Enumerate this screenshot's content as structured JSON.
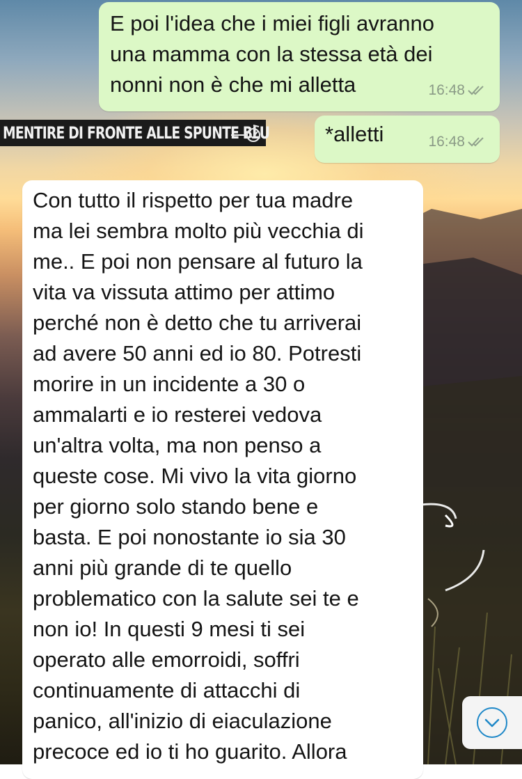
{
  "messages": [
    {
      "direction": "outgoing",
      "text": "E poi l'idea che i miei figli avranno\nuna mamma con la stessa età dei\nnonni non è che mi alletta",
      "time": "16:48",
      "status_icon": "double-check-icon"
    },
    {
      "direction": "outgoing",
      "text": "*alletti",
      "time": "16:48",
      "status_icon": "double-check-icon"
    },
    {
      "direction": "incoming",
      "text": "Con tutto il rispetto per tua madre\nma lei sembra molto più vecchia di\nme..  E poi non pensare al futuro la\nvita va vissuta attimo per attimo\nperché non è detto che tu arriverai\nad avere 50 anni ed io 80. Potresti\nmorire in un incidente a 30 o\nammalarti e io resterei vedova\nun'altra volta, ma non penso a\nqueste cose. Mi vivo la vita giorno\nper giorno solo stando bene e\nbasta. E poi nonostante io sia 30\nanni più grande di te quello\nproblematico con la salute sei te e\nnon io!  In questi 9 mesi ti sei\noperato alle emorroidi, soffri\ncontinuamente di attacchi di\npanico, all'inizio di eiaculazione\nprecoce ed io ti ho guarito. Allora"
    }
  ],
  "watermark": {
    "text": "MENTIRE DI FRONTE ALLE SPUNTE BLU",
    "icon": "double-check-icon"
  },
  "scroll_button": {
    "icon": "chevron-down-icon"
  },
  "colors": {
    "outgoing_bubble": "#dcf8c6",
    "incoming_bubble": "#ffffff",
    "timestamp": "#8a9a86",
    "scroll_accent": "#1e88c8"
  }
}
